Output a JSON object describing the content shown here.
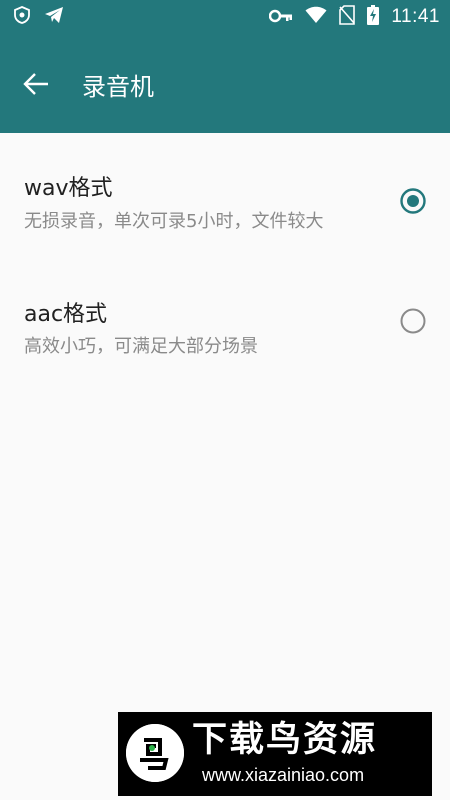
{
  "status_bar": {
    "time": "11:41",
    "left_icons": [
      "shield-icon",
      "telegram-icon"
    ],
    "right_icons": [
      "key-icon",
      "wifi-icon",
      "no-sim-icon",
      "battery-charging-icon"
    ]
  },
  "app_bar": {
    "title": "录音机",
    "back_icon": "arrow-back-icon",
    "color": "#23787c"
  },
  "options": [
    {
      "title": "wav格式",
      "summary": "无损录音，单次可录5小时，文件较大",
      "selected": true
    },
    {
      "title": "aac格式",
      "summary": "高效小巧，可满足大部分场景",
      "selected": false
    }
  ],
  "watermark": {
    "text": "下载鸟资源",
    "url": "www.xiazainiao.com"
  },
  "colors": {
    "accent": "#23787c",
    "background": "#fafafa",
    "title_text": "#212121",
    "summary_text": "#8a8a8a",
    "radio_unchecked": "#8a8a8a"
  }
}
